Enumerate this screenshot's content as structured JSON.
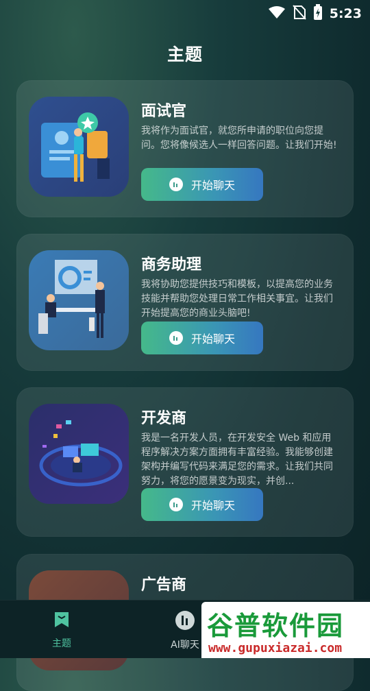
{
  "status": {
    "time": "5:23"
  },
  "header": {
    "title": "主题"
  },
  "cards": [
    {
      "title": "面试官",
      "description": "我将作为面试官，就您所申请的职位向您提问。您将像候选人一样回答问题。让我们开始!",
      "button": "开始聊天"
    },
    {
      "title": "商务助理",
      "description": "我将协助您提供技巧和模板，以提高您的业务技能并帮助您处理日常工作相关事宜。让我们开始提高您的商业头脑吧!",
      "button": "开始聊天"
    },
    {
      "title": "开发商",
      "description": "我是一名开发人员，在开发安全 Web 和应用程序解决方案方面拥有丰富经验。我能够创建架构并编写代码来满足您的需求。让我们共同努力，将您的愿景变为现实，并创...",
      "button": "开始聊天"
    },
    {
      "title": "广告商",
      "description": "",
      "button": ""
    }
  ],
  "nav": {
    "items": [
      {
        "label": "主题",
        "icon": "bookmark-chat-icon",
        "active": true
      },
      {
        "label": "AI聊天",
        "icon": "chat-bubble-icon",
        "active": false
      }
    ]
  },
  "watermark": {
    "main": "谷普软件园",
    "url": "www.gupuxiazai.com"
  },
  "colors": {
    "accent": "#4fc3a0",
    "button_start": "#45b98a",
    "button_end": "#3677c0"
  }
}
